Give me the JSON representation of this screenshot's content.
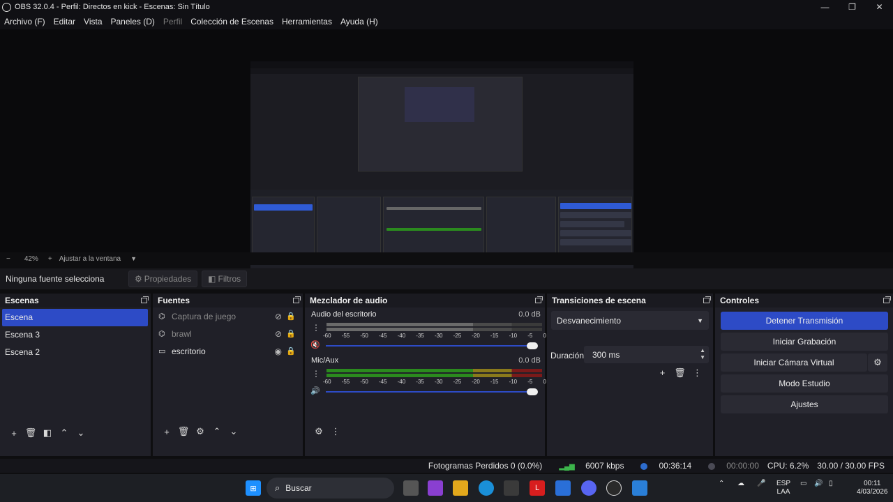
{
  "window": {
    "title": "OBS 32.0.4 - Perfil: Directos en kick - Escenas: Sin Título",
    "minimize": "—",
    "maximize": "❐",
    "close": "✕"
  },
  "menu": {
    "items": [
      "Archivo (F)",
      "Editar",
      "Vista",
      "Paneles (D)",
      "Perfil",
      "Colección de Escenas",
      "Herramientas",
      "Ayuda (H)"
    ]
  },
  "zoom": {
    "minus": "−",
    "value": "42%",
    "plus": "+",
    "fit_label": "Ajustar a la ventana"
  },
  "source_toolbar": {
    "no_source": "Ninguna fuente selecciona",
    "properties": "Propiedades",
    "filters": "Filtros"
  },
  "scenes": {
    "title": "Escenas",
    "items": [
      "Escena",
      "Escena 3",
      "Escena 2"
    ],
    "selected_index": 0
  },
  "sources": {
    "title": "Fuentes",
    "items": [
      {
        "name": "Captura de juego",
        "icon": "gamepad-icon",
        "visible": false
      },
      {
        "name": "brawl",
        "icon": "gamepad-icon",
        "visible": false
      },
      {
        "name": "escritorio",
        "icon": "monitor-icon",
        "visible": true
      }
    ]
  },
  "mixer": {
    "title": "Mezclador de audio",
    "channels": [
      {
        "name": "Audio del escritorio",
        "db": "0.0 dB",
        "muted": true
      },
      {
        "name": "Mic/Aux",
        "db": "0.0 dB",
        "muted": false
      }
    ],
    "ticks": [
      "-60",
      "-55",
      "-50",
      "-45",
      "-40",
      "-35",
      "-30",
      "-25",
      "-20",
      "-15",
      "-10",
      "-5",
      "0"
    ]
  },
  "transitions": {
    "title": "Transiciones de escena",
    "selected": "Desvanecimiento",
    "duration_label": "Duración",
    "duration_value": "300 ms"
  },
  "controls": {
    "title": "Controles",
    "buttons": [
      "Detener Transmisión",
      "Iniciar Grabación",
      "Iniciar Cámara Virtual",
      "Modo Estudio",
      "Ajustes"
    ]
  },
  "status": {
    "dropped_frames": "Fotogramas Perdidos 0 (0.0%)",
    "bitrate": "6007 kbps",
    "stream_time": "00:36:14",
    "rec_time": "00:00:00",
    "cpu": "CPU: 6.2%",
    "fps": "30.00 / 30.00 FPS"
  },
  "taskbar": {
    "search_label": "Buscar",
    "lang": "ESP",
    "layout": "LAA",
    "time": "00:11",
    "date": "4/03/2026"
  },
  "colors": {
    "accent": "#2d4bc6",
    "background": "#0e0e10",
    "dock": "#202028"
  }
}
